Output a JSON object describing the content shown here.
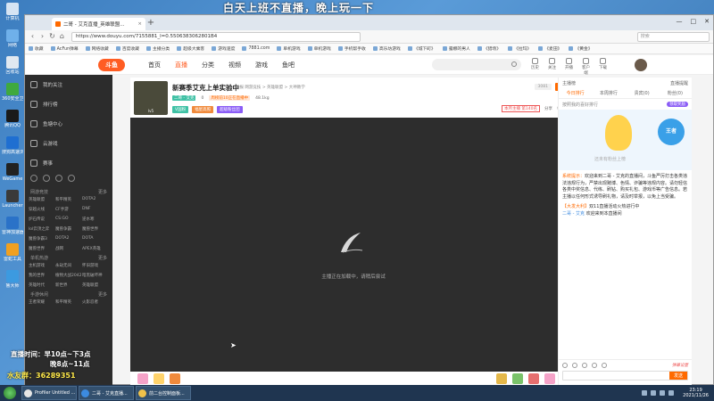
{
  "overlay": {
    "banner": "白天上班不直播，晚上玩一下",
    "hours_line1": "直播时间：早10点~下3点",
    "hours_line2": "晚8点~11点",
    "fans": "水友群：36289351"
  },
  "desktop_icons": [
    {
      "label": "计算机",
      "color": "#d6e4f3"
    },
    {
      "label": "网络",
      "color": "#6fb0ea"
    },
    {
      "label": "回收站",
      "color": "#e0e8f0"
    },
    {
      "label": "360安全卫士",
      "color": "#3fa93f"
    },
    {
      "label": "腾讯QQ",
      "color": "#1a1a1a"
    },
    {
      "label": "搜狗高速浏览器",
      "color": "#1f6fd1"
    },
    {
      "label": "WeGame",
      "color": "#222222"
    },
    {
      "label": "Launcher",
      "color": "#3a3a3a"
    },
    {
      "label": "雷神加速器",
      "color": "#2a72c8"
    },
    {
      "label": "雷蛇工具",
      "color": "#f0a020"
    },
    {
      "label": "鲁大师",
      "color": "#3c9ae0"
    }
  ],
  "browser": {
    "tab_title": "二哥 - 艾克直播_英雄联盟...",
    "url": "https://www.douyu.com/7155881_l=0.5506383062801B4",
    "search_placeholder": "搜索",
    "window_controls": [
      "—",
      "□",
      "✕"
    ],
    "bookmarks": [
      "收藏",
      "AcFun弹幕",
      "网络收藏",
      "百度收藏",
      "主播分类",
      "超级大乘客",
      "游戏速度",
      "7881.com",
      "单机游戏",
      "单机游戏",
      "手机帮手收",
      "高乐坊游戏",
      "《城下町》",
      "露娜的男人",
      "《猎场》",
      "《拉玛》",
      "《麦田》",
      "《黄金》"
    ]
  },
  "douyu": {
    "logo": "斗鱼",
    "nav": [
      "首页",
      "直播",
      "分类",
      "视频",
      "游戏",
      "鱼吧"
    ],
    "active_nav": "直播",
    "header_icons": [
      "历史",
      "关注",
      "开播",
      "客户端",
      "下载"
    ]
  },
  "sidebar": {
    "items": [
      "我的关注",
      "排行榜",
      "鱼塘中心",
      "云游戏",
      "赛事"
    ],
    "section1": "网游竞技",
    "section1_more": "更多",
    "grid1": [
      "英雄联盟",
      "和平精英",
      "DOTA2",
      "穿越火线",
      "CF手游",
      "DNF",
      "炉石传说",
      "CS:GO",
      "逆水寒",
      "lol云顶之弈",
      "魔兽争霸",
      "魔兽世界",
      "魔兽争霸3",
      "DOTA2",
      "DOTA",
      "魔兽世界",
      "战网",
      "APEX英雄"
    ],
    "section2": "单机热游",
    "section2_more": "更多",
    "grid2": [
      "主机游戏",
      "永劫无间",
      "怀旧游戏",
      "我的世界",
      "植物大战2042",
      "暗黑破坏神",
      "英雄时代",
      "新世界",
      "英雄联盟"
    ],
    "section3": "手游休闲",
    "section3_more": "更多",
    "grid3": [
      "王者荣耀",
      "和平精英",
      "火影忍者"
    ]
  },
  "room": {
    "title": "新赛季艾克上单实验中",
    "tags": "举报  网游竞技 > 英雄联盟 > 大神教学",
    "uid": "二哥 - 艾克",
    "level_badge": "lv5",
    "likes": "0",
    "activity": "周榜前10正在直播中",
    "viewers": "48.1kg",
    "buttons": [
      "V国粉",
      "福星高照",
      "超级粉丝团"
    ],
    "follow_count": "3081",
    "follow_label": "关注",
    "rank": "本月主播 第140名",
    "share": "分享",
    "report": "举报房间"
  },
  "player": {
    "status": "主播正在加载中，请稍后尝试"
  },
  "chat": {
    "top_left": "主播榜",
    "top_right": "直播提醒",
    "tabs": [
      "今日排行",
      "本周排行",
      "贵宾(0)",
      "粉丝(0)"
    ],
    "active_tab": "今日排行",
    "sub_text": "按照我的喜好排行",
    "sub_pill": "领取奖励",
    "banner_hint": "还未有粉丝上榜",
    "badge": "王者",
    "system_label": "系统提示：",
    "system_msg": "欢迎来到二哥 - 艾克的直播间，斗鱼严厉打击各类违法违规行为，严禁出现赌博、色情、诈骗等违规内容。请勿轻信各类中奖信息、代练、刷钻、购买礼包、游戏币等广告信息。若主播以任何形式诱导刷礼物，请及时举报，以免上当受骗。",
    "msg2_label": "【大发大利】",
    "msg2": "双11直播活动火热进行中",
    "msg3_user": "二哥 - 艾克",
    "msg3": "欢迎来到本直播间",
    "danmu_label": "弹幕设置",
    "send": "发送"
  },
  "taskbar": {
    "apps": [
      {
        "label": "Profiler Untitled ...",
        "color": "#e6e6e6"
      },
      {
        "label": "二哥 - 艾克直播...",
        "color": "#3c8be0"
      },
      {
        "label": "前二台控制面板...",
        "color": "#f0c24a"
      }
    ],
    "time": "23:19",
    "date": "2021/11/26"
  }
}
